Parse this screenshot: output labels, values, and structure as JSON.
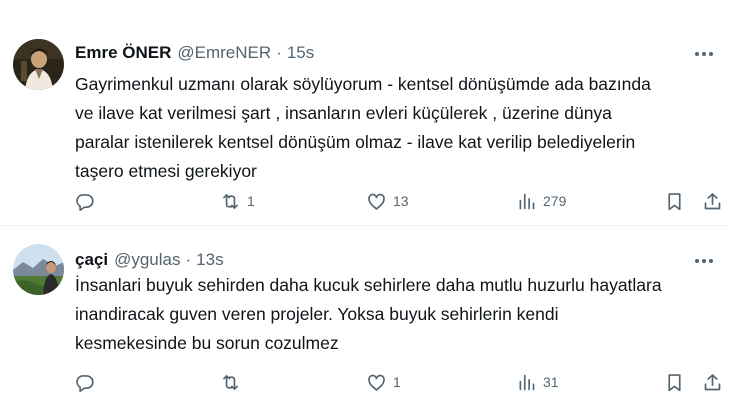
{
  "tweets": [
    {
      "author": {
        "name": "Emre ÖNER",
        "handle": "@EmreNER",
        "avatar": "avatar-emre"
      },
      "dot": "·",
      "time": "15s",
      "text": "Gayrimenkul uzmanı olarak söylüyorum - kentsel dönüşümde ada bazında\nve ilave kat verilmesi şart , insanların evleri küçülerek , üzerine dünya\nparalar istenilerek kentsel dönüşüm olmaz - ilave kat verilip belediyelerin\ntaşero etmesi gerekiyor",
      "stats": {
        "replies": "",
        "retweets": "1",
        "likes": "13",
        "views": "279"
      },
      "colors": {
        "like_icon": "#536471"
      }
    },
    {
      "author": {
        "name": "çaçi",
        "handle": "@ygulas",
        "avatar": "avatar-caci"
      },
      "dot": "·",
      "time": "13s",
      "text": "İnsanlari buyuk sehirden daha kucuk sehirlere daha mutlu huzurlu hayatlara\ninandiracak guven veren projeler. Yoksa buyuk sehirlerin kendi\nkesmekesinde bu sorun cozulmez",
      "stats": {
        "replies": "",
        "retweets": "",
        "likes": "1",
        "views": "31"
      },
      "colors": {
        "like_icon": "#536471"
      }
    }
  ],
  "icons": {
    "reply": "reply-icon",
    "retweet": "retweet-icon",
    "like": "heart-icon",
    "views": "views-icon",
    "bookmark": "bookmark-icon",
    "share": "share-icon",
    "more": "more-icon"
  },
  "colors": {
    "text": "#0f1419",
    "secondary": "#536471",
    "divider": "#eff3f4",
    "background": "#ffffff"
  }
}
